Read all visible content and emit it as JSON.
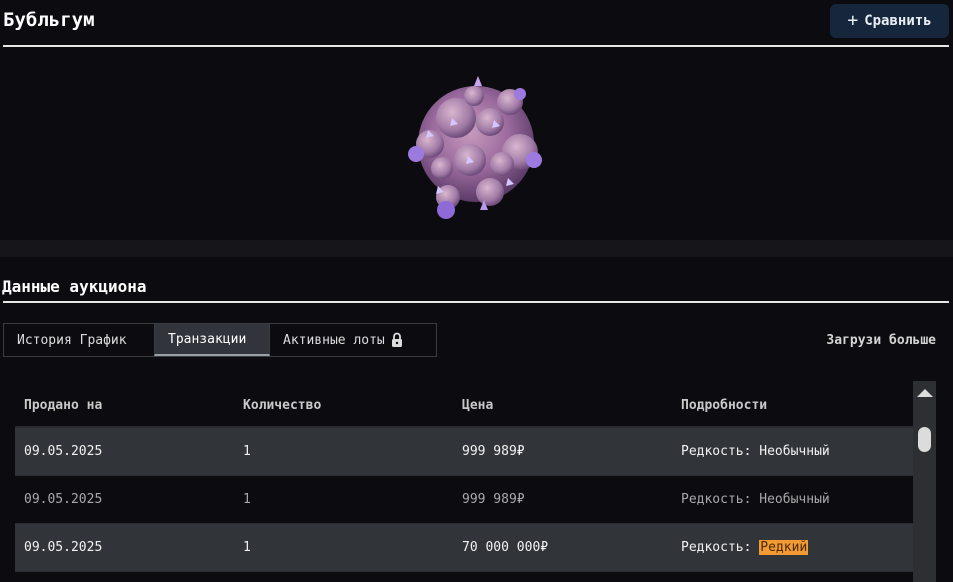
{
  "header": {
    "title": "Бубльгум",
    "compare_label": "Сравнить",
    "compare_icon": "plus-icon"
  },
  "item": {
    "image_icon": "bubblegum-artifact-image",
    "colors": {
      "main": "#9b6a9e",
      "accent": "#9d7ae0"
    }
  },
  "auction": {
    "section_title": "Данные аукциона",
    "tabs": [
      {
        "label": "История График",
        "active": false
      },
      {
        "label": "Транзакции",
        "active": true
      },
      {
        "label": "Активные лоты",
        "active": false,
        "icon": "lock-icon"
      }
    ],
    "load_more": "Загрузи больше",
    "table": {
      "headers": [
        "Продано на",
        "Количество",
        "Цена",
        "Подробности"
      ],
      "rows": [
        {
          "date": "09.05.2025",
          "qty": "1",
          "price": "999 989₽",
          "details_label": "Редкость:",
          "rarity": "Необычный",
          "rarity_highlight": false
        },
        {
          "date": "09.05.2025",
          "qty": "1",
          "price": "999 989₽",
          "details_label": "Редкость:",
          "rarity": "Необычный",
          "rarity_highlight": false
        },
        {
          "date": "09.05.2025",
          "qty": "1",
          "price": "70 000 000₽",
          "details_label": "Редкость:",
          "rarity": "Редкий",
          "rarity_highlight": true
        }
      ]
    }
  },
  "colors": {
    "background": "#0c0c10",
    "compare_button": "#16273d",
    "row_stripe": "#31353a",
    "rare_highlight": "#f39a34"
  }
}
